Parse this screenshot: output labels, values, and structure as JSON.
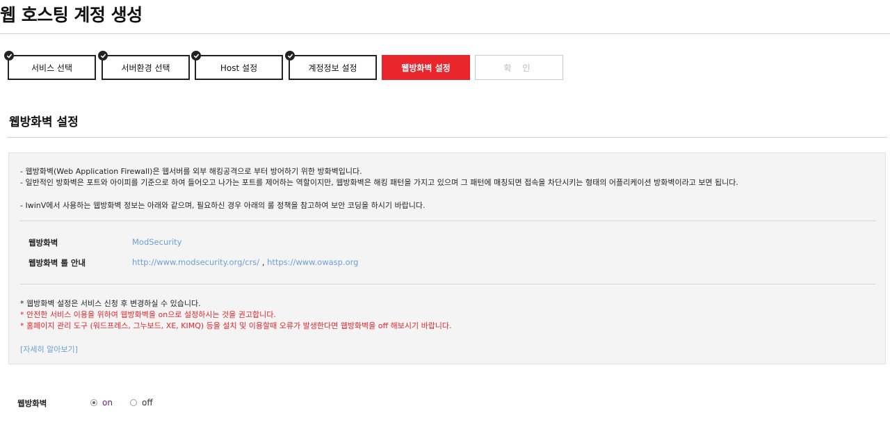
{
  "page": {
    "title": "웹 호스팅 계정 생성"
  },
  "steps": [
    {
      "label": "서비스 선택",
      "state": "done"
    },
    {
      "label": "서버환경 선택",
      "state": "done"
    },
    {
      "label": "Host 설정",
      "state": "done"
    },
    {
      "label": "계정정보 설정",
      "state": "done"
    },
    {
      "label": "웹방화벽 설정",
      "state": "active"
    },
    {
      "label": "확 인",
      "state": "pending"
    }
  ],
  "section": {
    "title": "웹방화벽 설정"
  },
  "info": {
    "line1": "- 웹방화벽(Web Application Firewall)은 웹서버를 외부 해킹공격으로 부터 방어하기 위한 방화벽입니다.",
    "line2": "- 일반적인 방화벽은 포트와 아이피를 기준으로 하여 들어오고 나가는 포트를 제어하는 역할이지만, 웹방화벽은 해킹 패턴을 가지고 있으며 그 패턴에 매칭되면 접속을 차단시키는 형태의 어플리케이션 방화벽이라고 보면 됩니다.",
    "line3": "- IwinV에서 사용하는 웹방화벽 정보는 아래와 같으며, 필요하신 경우 아래의 룰 정책을 참고하여 보안 코딩을 하시기 바랍니다.",
    "waf_label": "웹방화벽",
    "waf_value": "ModSecurity",
    "rule_label": "웹방화벽 룰 안내",
    "rule_link1": "http://www.modsecurity.org/crs/",
    "rule_sep": ",",
    "rule_link2": "https://www.owasp.org",
    "note1": "* 웹방화벽 설정은 서비스 신청 후 변경하실 수 있습니다.",
    "note2": "* 안전한 서비스 이용을 위하여 웹방화벽을 on으로 설정하시는 것을 권고합니다.",
    "note3": "* 홈페이지 관리 도구 (워드프레스, 그누보드, XE, KIMQ) 등을 설치 및 이용할때 오류가 발생한다면 웹방화벽을 off 해보시기 바랍니다.",
    "more_link": "[자세히 알아보기]"
  },
  "waf_setting": {
    "label": "웹방화벽",
    "options": [
      {
        "label": "on",
        "checked": true
      },
      {
        "label": "off",
        "checked": false
      }
    ]
  },
  "colors": {
    "accent": "#e8262b",
    "link": "#6b9fd6",
    "warning_text": "#e3262b"
  }
}
